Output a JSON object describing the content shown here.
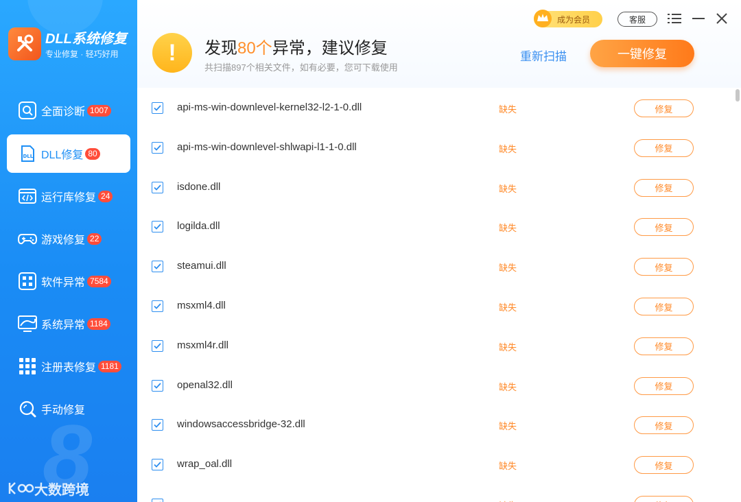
{
  "app": {
    "title": "DLL系统修复",
    "subtitle": "专业修复 · 轻巧好用"
  },
  "nav": [
    {
      "label": "全面诊断",
      "badge": "1007",
      "icon": "diagnose-icon"
    },
    {
      "label": "DLL修复",
      "badge": "80",
      "icon": "dll-icon",
      "active": true
    },
    {
      "label": "运行库修复",
      "badge": "24",
      "icon": "runtime-icon"
    },
    {
      "label": "游戏修复",
      "badge": "22",
      "icon": "gamepad-icon"
    },
    {
      "label": "软件异常",
      "badge": "7584",
      "icon": "software-icon"
    },
    {
      "label": "系统异常",
      "badge": "1184",
      "icon": "system-icon"
    },
    {
      "label": "注册表修复",
      "badge": "1181",
      "icon": "registry-icon"
    },
    {
      "label": "手动修复",
      "badge": "",
      "icon": "manual-icon"
    }
  ],
  "decor": {
    "big_number": "8",
    "watermark": "大数跨境"
  },
  "topbar": {
    "vip_label": "成为会员",
    "service_label": "客服"
  },
  "header": {
    "title_prefix": "发现",
    "count": "80个",
    "title_suffix": "异常，建议修复",
    "subtitle": "共扫描897个相关文件，如有必要，您可下载使用",
    "rescan_label": "重新扫描",
    "fix_all_label": "一键修复"
  },
  "items": [
    {
      "name": "api-ms-win-downlevel-kernel32-l2-1-0.dll",
      "status": "缺失",
      "action": "修复"
    },
    {
      "name": "api-ms-win-downlevel-shlwapi-l1-1-0.dll",
      "status": "缺失",
      "action": "修复"
    },
    {
      "name": "isdone.dll",
      "status": "缺失",
      "action": "修复"
    },
    {
      "name": "logilda.dll",
      "status": "缺失",
      "action": "修复"
    },
    {
      "name": "steamui.dll",
      "status": "缺失",
      "action": "修复"
    },
    {
      "name": "msxml4.dll",
      "status": "缺失",
      "action": "修复"
    },
    {
      "name": "msxml4r.dll",
      "status": "缺失",
      "action": "修复"
    },
    {
      "name": "openal32.dll",
      "status": "缺失",
      "action": "修复"
    },
    {
      "name": "windowsaccessbridge-32.dll",
      "status": "缺失",
      "action": "修复"
    },
    {
      "name": "wrap_oal.dll",
      "status": "缺失",
      "action": "修复"
    },
    {
      "name": "",
      "status": "缺失",
      "action": "修复"
    }
  ],
  "colors": {
    "accent": "#1e8ff5",
    "orange": "#ff8a2a",
    "badge": "#ff4d3a"
  }
}
